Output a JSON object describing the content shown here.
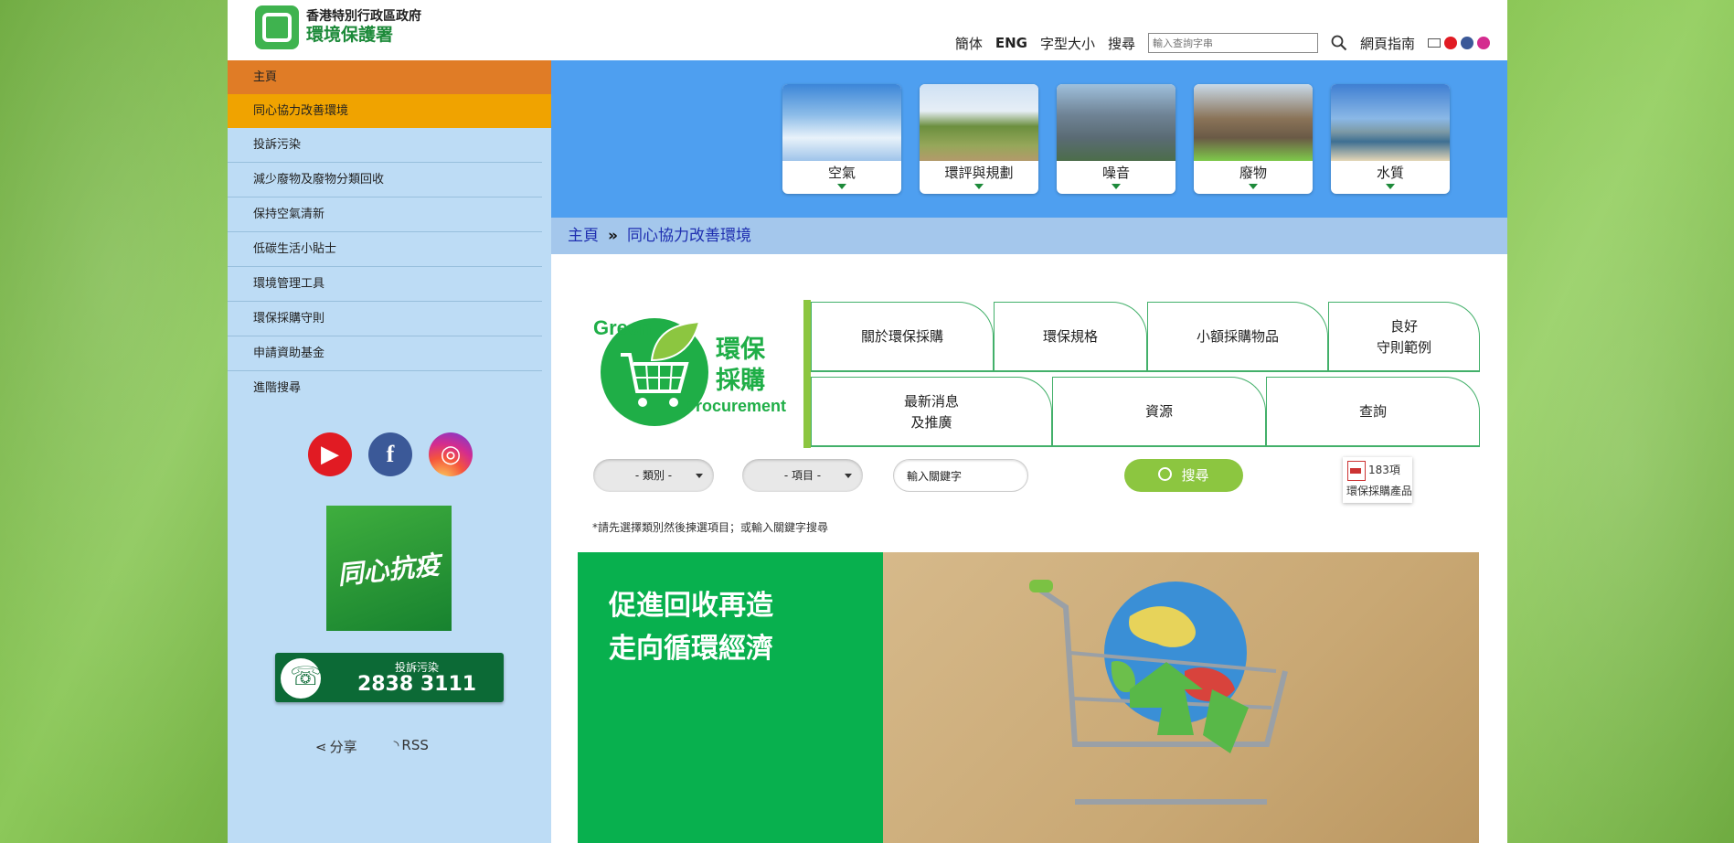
{
  "header": {
    "org_line1": "香港特別行政區政府",
    "org_line2": "環境保護署",
    "links": {
      "simplified": "簡体",
      "english": "ENG",
      "font_size": "字型大小",
      "search": "搜尋",
      "sitemap": "網頁指南"
    },
    "search_placeholder": "輸入查詢字串"
  },
  "sidebar": {
    "items": [
      {
        "label": "主頁"
      },
      {
        "label": "同心協力改善環境"
      },
      {
        "label": "投訴污染"
      },
      {
        "label": "減少廢物及廢物分類回收"
      },
      {
        "label": "保持空氣清新"
      },
      {
        "label": "低碳生活小貼士"
      },
      {
        "label": "環境管理工具"
      },
      {
        "label": "環保採購守則"
      },
      {
        "label": "申請資助基金"
      },
      {
        "label": "進階搜尋"
      }
    ],
    "covid_banner": "同心抗疫",
    "hotline_label": "投訴污染",
    "hotline_number": "2838 3111",
    "share": "分享",
    "rss": "RSS"
  },
  "banner": {
    "tiles": [
      {
        "label": "空氣"
      },
      {
        "label": "環評與規劃"
      },
      {
        "label": "噪音"
      },
      {
        "label": "廢物"
      },
      {
        "label": "水質"
      }
    ]
  },
  "breadcrumb": {
    "home": "主頁",
    "separator": "»",
    "current": "同心協力改善環境"
  },
  "gp": {
    "logo_cn_1": "環保",
    "logo_cn_2": "採購",
    "logo_green": "Green",
    "logo_procurement": "Procurement",
    "tabs_row1": [
      "關於環保採購",
      "環保規格",
      "小額採購物品",
      "良好\n守則範例"
    ],
    "tabs_row2": [
      "最新消息\n及推廣",
      "資源",
      "查詢"
    ],
    "category": "- 類別 -",
    "item": "- 項目 -",
    "keyword": "輸入關鍵字",
    "search_label": "搜尋",
    "count": "183項",
    "count_label": "環保採購產品",
    "hint": "*請先選擇類別然後揀選項目；或輸入關鍵字搜尋"
  },
  "feature": {
    "line1": "促進回收再造",
    "line2": "走向循環經濟"
  }
}
